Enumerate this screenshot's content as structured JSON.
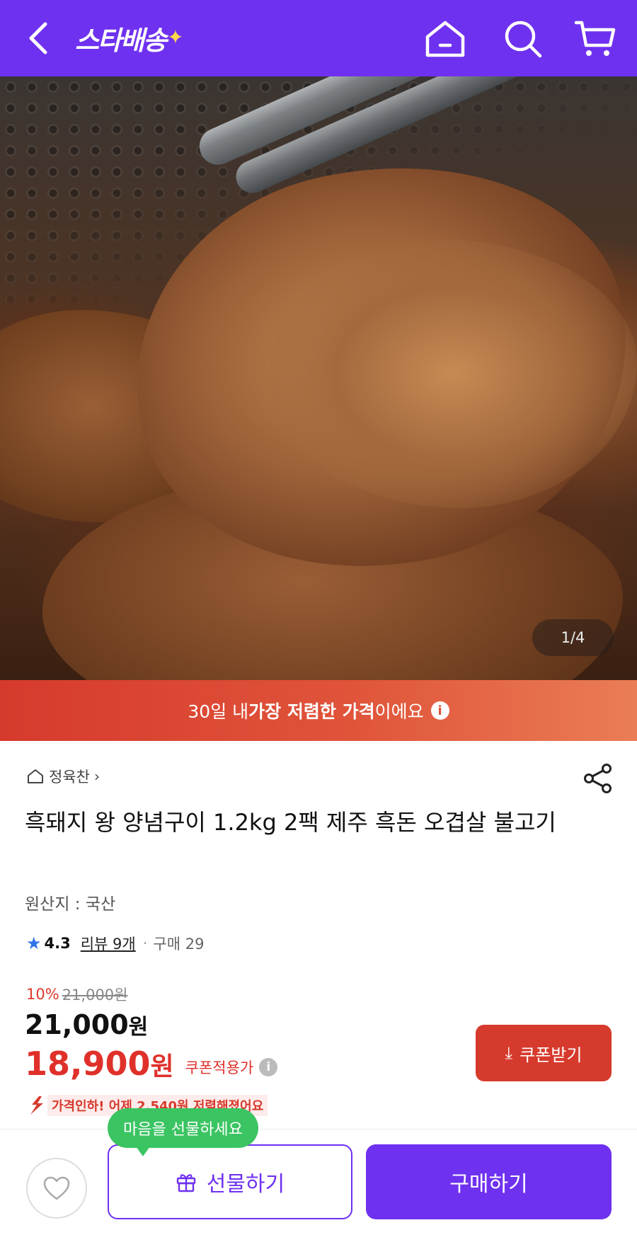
{
  "header": {
    "logo_text": "스타배송",
    "logo_star": "✦",
    "back_icon": "chevron-left-icon",
    "home_icon": "home-icon",
    "search_icon": "search-icon",
    "cart_icon": "cart-icon",
    "background_color": "#6f31f0"
  },
  "hero": {
    "image_counter": "1/4"
  },
  "banner": {
    "prefix": "30일 내 ",
    "highlight": "가장 저렴한 가격",
    "suffix": "이에요",
    "info_icon": "i"
  },
  "product": {
    "store_name": "정육찬",
    "store_chevron": "›",
    "title": "흑돼지 왕 양념구이 1.2kg 2팩 제주 흑돈 오겹살 불고기",
    "origin": "원산지 : 국산",
    "rating": "4.3",
    "reviews_label": "리뷰 9개",
    "separator": "·",
    "purchase_count": "구매 29"
  },
  "pricing": {
    "discount_percent": "10%",
    "original_price": "21,000원",
    "price_number": "21,000",
    "price_unit": "원",
    "coupon_price_number": "18,900",
    "coupon_price_unit": "원",
    "coupon_note": "쿠폰적용가",
    "coupon_info_icon": "i",
    "coupon_button_icon": "⤓",
    "coupon_button_label": "쿠폰받기",
    "price_drop_text": "가격인하! 어제 2,540원 저렴해졌어요",
    "accent_red": "#e0302a"
  },
  "bottom_bar": {
    "tooltip": "마음을 선물하세요",
    "gift_label": "선물하기",
    "buy_label": "구매하기",
    "tooltip_color": "#3bc462",
    "primary_color": "#6f31f0"
  }
}
